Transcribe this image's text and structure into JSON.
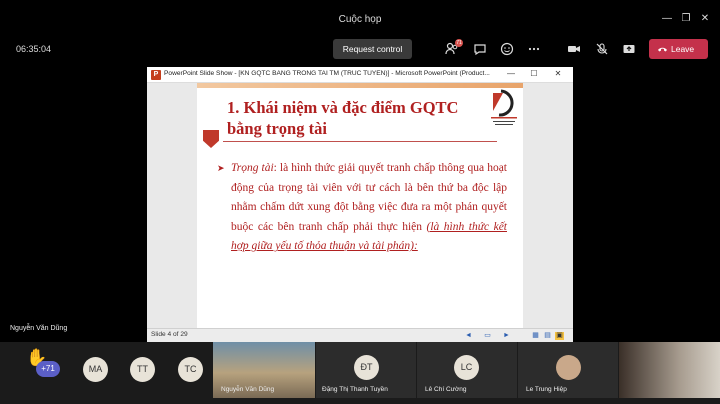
{
  "window": {
    "title": "Cuộc họp",
    "minimize": "—",
    "restore": "❐",
    "close": "✕"
  },
  "toolbar": {
    "timer": "06:35:04",
    "request_control": "Request control",
    "people_badge": "71",
    "leave": "Leave"
  },
  "ppt": {
    "logo_letter": "P",
    "title": "PowerPoint Slide Show - [KN GQTC BANG TRONG TAI TM (TRUC TUYEN)] - Microsoft PowerPoint (Product...",
    "minimize": "—",
    "restore": "☐",
    "close": "✕",
    "slide": {
      "title": "1. Khái niệm và đặc điểm GQTC bằng trọng tài",
      "bullet": "➤",
      "body_em": "Trọng tài",
      "body_text": ": là hình thức giải quyết tranh chấp thông qua hoạt động của trọng tài viên với tư cách là bên thứ ba độc lập nhằm chấm dứt xung đột bằng việc đưa ra một phán quyết buộc các bên tranh chấp phải thực hiện ",
      "body_underline": "(là hình thức kết hợp giữa yếu tố thỏa thuận và tài phán):"
    },
    "status": {
      "slide_counter": "Slide 4 of 29"
    }
  },
  "main_presenter": "Nguyễn Văn Dũng",
  "participants": {
    "more_count": "+71",
    "avatars": [
      "MA",
      "TT",
      "TC"
    ],
    "tiles": [
      {
        "name": "Nguyễn Văn Dũng"
      },
      {
        "initials": "ĐT",
        "name": "Đặng Thị Thanh Tuyền"
      },
      {
        "initials": "LC",
        "name": "Lê Chí Cường"
      },
      {
        "name": "Le Trung Hiệp"
      }
    ]
  },
  "colors": {
    "accent": "#5b5fc7",
    "leave": "#c4314b",
    "slide_text": "#b02020"
  }
}
